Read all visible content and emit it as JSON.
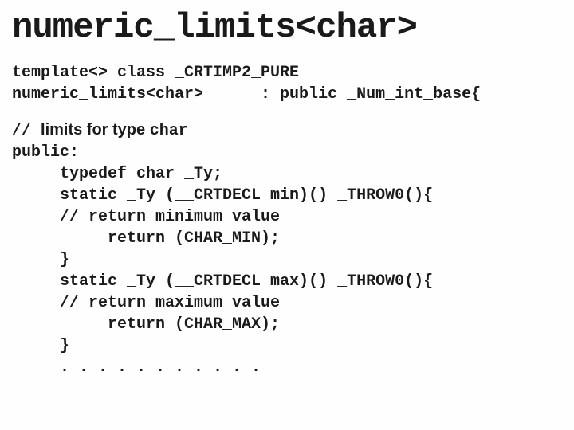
{
  "title": "numeric_limits<char>",
  "lines": {
    "l1": "template<> class _CRTIMP2_PURE",
    "l2": "numeric_limits<char>      : public _Num_int_base{",
    "comment_prefix": "// ",
    "comment_text": "limits for type  ",
    "comment_mono": "char",
    "l4": "public:",
    "l5": "     typedef char _Ty;",
    "l6": "     static _Ty (__CRTDECL min)() _THROW0(){",
    "l7": "     // return minimum value",
    "l8": "          return (CHAR_MIN);",
    "l9": "     }",
    "l10": "     static _Ty (__CRTDECL max)() _THROW0(){",
    "l11": "     // return maximum value",
    "l12": "          return (CHAR_MAX);",
    "l13": "     }",
    "l14": "     . . . . . . . . . . ."
  }
}
